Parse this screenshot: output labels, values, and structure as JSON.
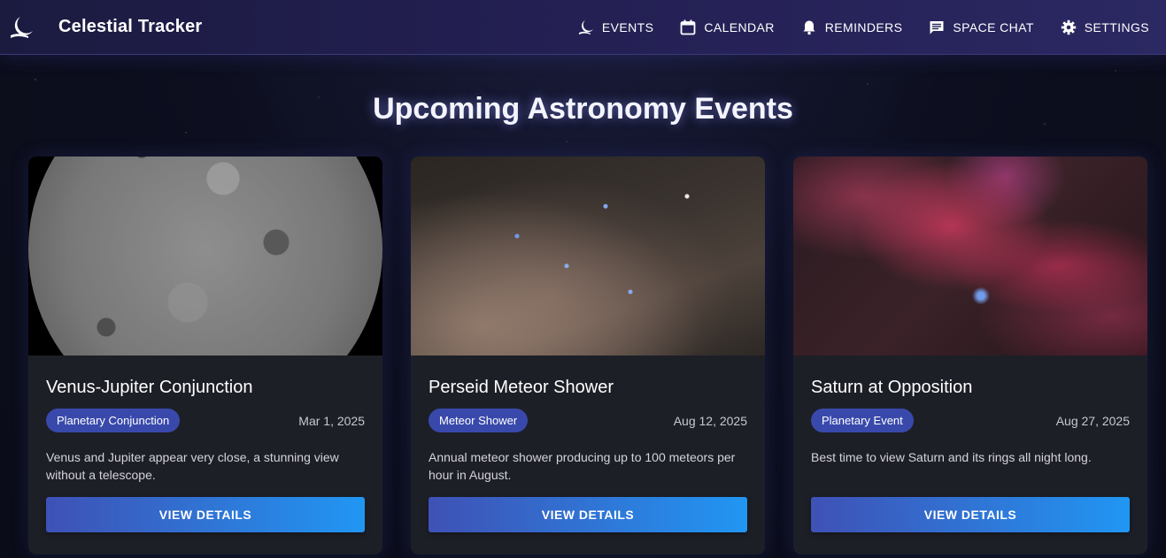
{
  "app": {
    "title": "Celestial Tracker",
    "logo_icon": "moon-icon"
  },
  "nav": [
    {
      "label": "EVENTS",
      "icon": "moon-icon"
    },
    {
      "label": "CALENDAR",
      "icon": "calendar-icon"
    },
    {
      "label": "REMINDERS",
      "icon": "bell-icon"
    },
    {
      "label": "SPACE CHAT",
      "icon": "chat-icon"
    },
    {
      "label": "SETTINGS",
      "icon": "gear-icon"
    }
  ],
  "page": {
    "title": "Upcoming Astronomy Events"
  },
  "events": [
    {
      "title": "Venus-Jupiter Conjunction",
      "category": "Planetary Conjunction",
      "date": "Mar 1, 2025",
      "description": "Venus and Jupiter appear very close, a stunning view without a telescope.",
      "button_label": "VIEW DETAILS",
      "image": "moon-surface"
    },
    {
      "title": "Perseid Meteor Shower",
      "category": "Meteor Shower",
      "date": "Aug 12, 2025",
      "description": "Annual meteor shower producing up to 100 meteors per hour in August.",
      "button_label": "VIEW DETAILS",
      "image": "starfield"
    },
    {
      "title": "Saturn at Opposition",
      "category": "Planetary Event",
      "date": "Aug 27, 2025",
      "description": "Best time to view Saturn and its rings all night long.",
      "button_label": "VIEW DETAILS",
      "image": "nebula"
    }
  ],
  "colors": {
    "header_start": "#1b1b40",
    "header_end": "#2b2862",
    "badge": "#3949ab",
    "button_start": "#3f51b5",
    "button_end": "#2196f3",
    "card_bg": "#1d1f27"
  }
}
